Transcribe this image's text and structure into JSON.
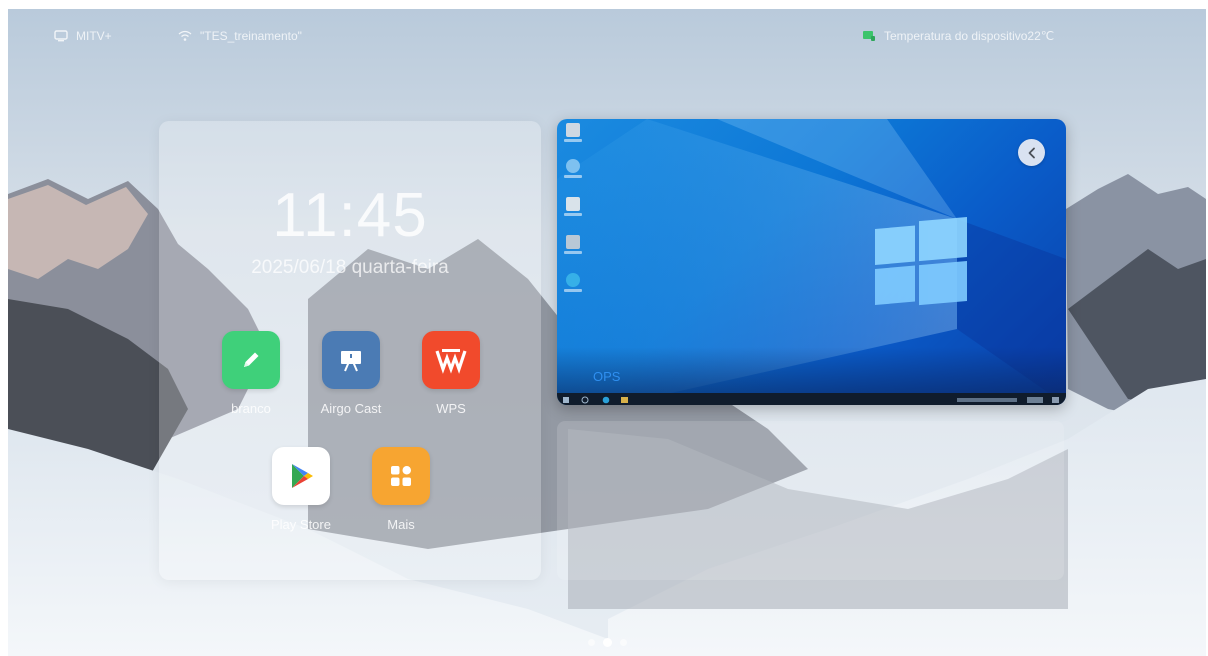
{
  "status_bar": {
    "source": "MITV+",
    "wifi": "\"TES_treinamento\"",
    "temperature": "Temperatura do dispositivo22℃"
  },
  "home": {
    "time": "11:45",
    "date": "2025/06/18 quarta-feira",
    "apps": [
      {
        "label": "branco",
        "icon": "pencil-icon",
        "color": "#3fd07a"
      },
      {
        "label": "Airgo Cast",
        "icon": "cast-screen-icon",
        "color": "#4b7bb4"
      },
      {
        "label": "WPS",
        "icon": "wps-icon",
        "color": "#f14a2c"
      },
      {
        "label": "Play Store",
        "icon": "play-store-icon",
        "color": "#ffffff"
      },
      {
        "label": "Mais",
        "icon": "grid-icon",
        "color": "#f7a531"
      }
    ]
  },
  "ops": {
    "label": "OPS",
    "back_icon": "chevron-left-icon"
  },
  "pagination": {
    "pages": 3,
    "active": 2
  }
}
